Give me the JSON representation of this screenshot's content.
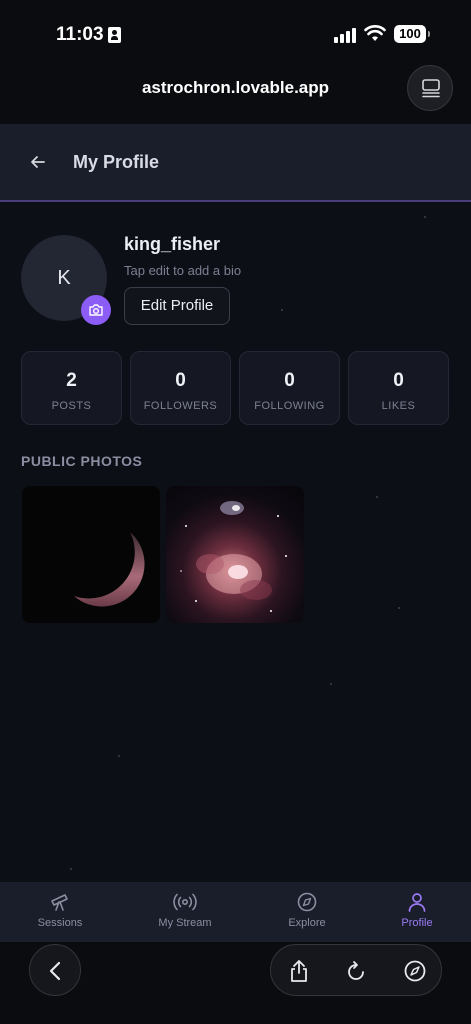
{
  "status_bar": {
    "time": "11:03",
    "battery": "100"
  },
  "browser": {
    "url": "astrochron.lovable.app"
  },
  "header": {
    "title": "My Profile"
  },
  "profile": {
    "avatar_initial": "K",
    "username": "king_fisher",
    "bio_placeholder": "Tap edit to add a bio",
    "edit_button": "Edit Profile"
  },
  "stats": [
    {
      "value": "2",
      "label": "POSTS"
    },
    {
      "value": "0",
      "label": "FOLLOWERS"
    },
    {
      "value": "0",
      "label": "FOLLOWING"
    },
    {
      "value": "0",
      "label": "LIKES"
    }
  ],
  "photos_section": {
    "title": "PUBLIC PHOTOS"
  },
  "nav": {
    "items": [
      {
        "label": "Sessions",
        "icon": "telescope-icon"
      },
      {
        "label": "My Stream",
        "icon": "broadcast-icon"
      },
      {
        "label": "Explore",
        "icon": "compass-icon"
      },
      {
        "label": "Profile",
        "icon": "user-icon"
      }
    ],
    "active": "Profile"
  },
  "colors": {
    "accent": "#8b5cf6",
    "background": "#0d0f17",
    "header": "#1a1e2b"
  }
}
